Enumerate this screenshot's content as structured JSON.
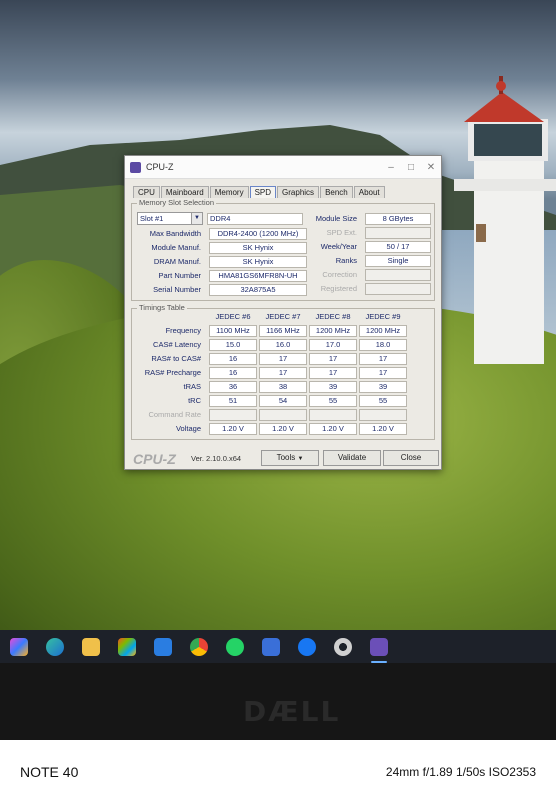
{
  "window": {
    "title": "CPU-Z",
    "minimize": "–",
    "maximize": "□",
    "close": "✕"
  },
  "tabs": [
    "CPU",
    "Mainboard",
    "Memory",
    "SPD",
    "Graphics",
    "Bench",
    "About"
  ],
  "active_tab": "SPD",
  "memory_slot": {
    "group_label": "Memory Slot Selection",
    "slot": "Slot #1",
    "type": "DDR4",
    "rows": [
      {
        "label": "Max Bandwidth",
        "value": "DDR4-2400 (1200 MHz)"
      },
      {
        "label": "Module Manuf.",
        "value": "SK Hynix"
      },
      {
        "label": "DRAM Manuf.",
        "value": "SK Hynix"
      },
      {
        "label": "Part Number",
        "value": "HMA81GS6MFR8N-UH"
      },
      {
        "label": "Serial Number",
        "value": "32A875A5"
      }
    ],
    "right_rows": [
      {
        "label": "Module Size",
        "value": "8 GBytes",
        "enabled": true
      },
      {
        "label": "SPD Ext.",
        "value": "",
        "enabled": false
      },
      {
        "label": "Week/Year",
        "value": "50 / 17",
        "enabled": true
      },
      {
        "label": "Ranks",
        "value": "Single",
        "enabled": true
      },
      {
        "label": "Correction",
        "value": "",
        "enabled": false
      },
      {
        "label": "Registered",
        "value": "",
        "enabled": false
      }
    ]
  },
  "timings": {
    "group_label": "Timings Table",
    "columns": [
      "JEDEC #6",
      "JEDEC #7",
      "JEDEC #8",
      "JEDEC #9"
    ],
    "rows": [
      {
        "label": "Frequency",
        "values": [
          "1100 MHz",
          "1166 MHz",
          "1200 MHz",
          "1200 MHz"
        ]
      },
      {
        "label": "CAS# Latency",
        "values": [
          "15.0",
          "16.0",
          "17.0",
          "18.0"
        ]
      },
      {
        "label": "RAS# to CAS#",
        "values": [
          "16",
          "17",
          "17",
          "17"
        ]
      },
      {
        "label": "RAS# Precharge",
        "values": [
          "16",
          "17",
          "17",
          "17"
        ]
      },
      {
        "label": "tRAS",
        "values": [
          "36",
          "38",
          "39",
          "39"
        ]
      },
      {
        "label": "tRC",
        "values": [
          "51",
          "54",
          "55",
          "55"
        ]
      },
      {
        "label": "Command Rate",
        "values": [
          "",
          "",
          "",
          ""
        ]
      },
      {
        "label": "Voltage",
        "values": [
          "1.20 V",
          "1.20 V",
          "1.20 V",
          "1.20 V"
        ]
      }
    ]
  },
  "footer": {
    "brand": "CPU-Z",
    "version": "Ver. 2.10.0.x64",
    "tools": "Tools",
    "validate": "Validate",
    "close": "Close"
  },
  "photo_caption": {
    "device": "NOTE 40",
    "exif": "24mm f/1.89 1/50s ISO2353"
  },
  "laptop_logo": "DÆLL",
  "taskbar_icons": [
    "copilot-icon",
    "edge-icon",
    "file-explorer-icon",
    "store-icon",
    "mail-icon",
    "chrome-icon",
    "whatsapp-icon",
    "app-icon",
    "facebook-icon",
    "settings-icon",
    "cpu-z-icon"
  ],
  "colors": {
    "accent": "#6a86c8",
    "text": "#1d2a6a"
  }
}
